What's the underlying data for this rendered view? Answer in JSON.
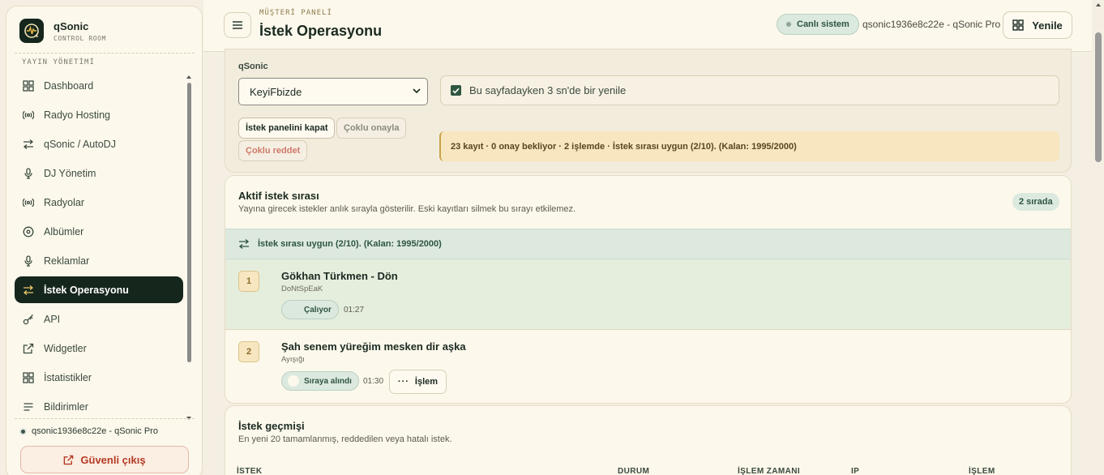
{
  "sidebar": {
    "brand_name": "qSonic",
    "brand_sub": "CONTROL ROOM",
    "section_label": "YAYIN YÖNETİMİ",
    "items": [
      {
        "label": "Dashboard",
        "icon": "grid-icon"
      },
      {
        "label": "Radyo Hosting",
        "icon": "broadcast-icon"
      },
      {
        "label": "qSonic / AutoDJ",
        "icon": "swap-icon"
      },
      {
        "label": "DJ Yönetim",
        "icon": "microphone-icon"
      },
      {
        "label": "Radyolar",
        "icon": "broadcast-icon"
      },
      {
        "label": "Albümler",
        "icon": "disc-icon"
      },
      {
        "label": "Reklamlar",
        "icon": "microphone-icon"
      },
      {
        "label": "İstek Operasyonu",
        "icon": "swap-icon",
        "active": true
      },
      {
        "label": "API",
        "icon": "key-icon"
      },
      {
        "label": "Widgetler",
        "icon": "external-link-icon"
      },
      {
        "label": "İstatistikler",
        "icon": "grid-icon"
      },
      {
        "label": "Bildirimler",
        "icon": "list-icon"
      }
    ],
    "user": "qsonic1936e8c22e - qSonic Pro",
    "logout_label": "Güvenli çıkış"
  },
  "header": {
    "eyebrow": "MÜŞTERİ PANELİ",
    "title": "İstek Operasyonu",
    "live_label": "Canlı sistem",
    "account": "qsonic1936e8c22e - qSonic Pro",
    "refresh_label": "Yenile"
  },
  "controls": {
    "field_label": "qSonic",
    "select_value": "KeyiFbizde",
    "auto_refresh_label": "Bu sayfadayken 3 sn'de bir yenile",
    "close_panel_label": "İstek panelini kapat",
    "bulk_approve_label": "Çoklu onayla",
    "bulk_reject_label": "Çoklu reddet",
    "notice": "23 kayıt · 0 onay bekliyor · 2 işlemde · İstek sırası uygun (2/10). (Kalan: 1995/2000)"
  },
  "queue": {
    "title": "Aktif istek sırası",
    "subtitle": "Yayına girecek istekler anlık sırayla gösterilir. Eski kayıtları silmek bu sırayı etkilemez.",
    "count_badge": "2 sırada",
    "status": "İstek sırası uygun (2/10). (Kalan: 1995/2000)",
    "items": [
      {
        "num": "1",
        "title": "Gökhan Türkmen - Dön",
        "requester": "DoNtSpEaK",
        "state": "Çalıyor",
        "time": "01:27"
      },
      {
        "num": "2",
        "title": "Şah senem yüreğim mesken dir aşka",
        "requester": "Ayışığı",
        "state": "Sıraya alındı",
        "time": "01:30",
        "action": "İşlem"
      }
    ]
  },
  "history": {
    "title": "İstek geçmişi",
    "subtitle": "En yeni 20 tamamlanmış, reddedilen veya hatalı istek.",
    "columns": [
      "İSTEK",
      "DURUM",
      "İŞLEM ZAMANI",
      "IP",
      "İŞLEM"
    ]
  },
  "colors": {
    "accent_dark": "#15261d",
    "accent_green": "#2e5540",
    "notice_bg": "#f7e6bf",
    "danger": "#b43a24"
  }
}
